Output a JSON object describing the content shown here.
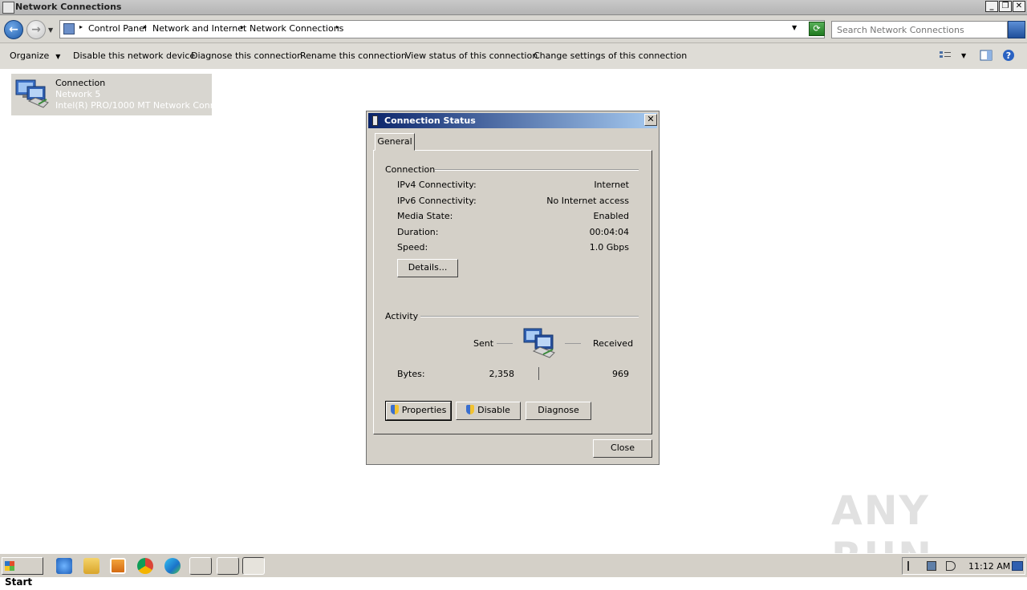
{
  "window": {
    "title": "Network Connections"
  },
  "address": {
    "crumbs": [
      "Control Panel",
      "Network and Internet",
      "Network Connections"
    ]
  },
  "search": {
    "placeholder": "Search Network Connections"
  },
  "toolbar": {
    "organize": "Organize",
    "disable_device": "Disable this network device",
    "diagnose": "Diagnose this connection",
    "rename": "Rename this connection",
    "view_status": "View status of this connection",
    "change_settings": "Change settings of this connection"
  },
  "connection_item": {
    "name": "Connection",
    "network": "Network  5",
    "adapter": "Intel(R) PRO/1000 MT Network Conn..."
  },
  "dialog": {
    "title": "Connection Status",
    "tab": "General",
    "connection_group": "Connection",
    "rows": [
      {
        "label": "IPv4 Connectivity:",
        "value": "Internet"
      },
      {
        "label": "IPv6 Connectivity:",
        "value": "No Internet access"
      },
      {
        "label": "Media State:",
        "value": "Enabled"
      },
      {
        "label": "Duration:",
        "value": "00:04:04"
      },
      {
        "label": "Speed:",
        "value": "1.0 Gbps"
      }
    ],
    "details_button": "Details...",
    "activity_group": "Activity",
    "sent_label": "Sent",
    "received_label": "Received",
    "bytes_label": "Bytes:",
    "bytes_sent": "2,358",
    "bytes_received": "969",
    "properties_button": "Properties",
    "disable_button": "Disable",
    "diagnose_button": "Diagnose",
    "close_button": "Close"
  },
  "taskbar": {
    "start": "Start",
    "clock": "11:12 AM"
  },
  "watermark": "ANY RUN"
}
